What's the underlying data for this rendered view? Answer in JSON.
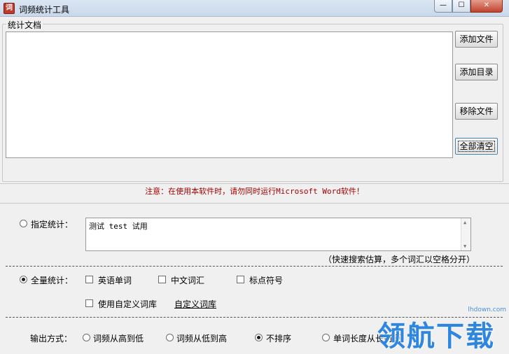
{
  "window": {
    "title": "词频统计工具",
    "icon_glyph": "词",
    "min_glyph": "—",
    "max_glyph": "☐",
    "close_glyph": "✕"
  },
  "documents": {
    "group_label": "统计文档",
    "add_file": "添加文件",
    "add_dir": "添加目录",
    "remove_file": "移除文件",
    "clear_all": "全部清空"
  },
  "notice": {
    "prefix": "注意：在使用本软件时，请勿同时运行",
    "app": "Microsoft Word",
    "suffix": "软件！"
  },
  "specified": {
    "label": "指定统计：",
    "value": "测试 test 试用",
    "hint": "（快速搜索估算，多个词汇以空格分开）",
    "checked": false
  },
  "full": {
    "label": "全量统计：",
    "checked": true,
    "english": "英语单词",
    "chinese": "中文词汇",
    "punct": "标点符号",
    "custom": "使用自定义词库",
    "custom_link": "自定义词库"
  },
  "output": {
    "label": "输出方式：",
    "opt1": "词频从高到低",
    "opt2": "词频从低到高",
    "opt3": "不排序",
    "opt4": "单词长度从长到短",
    "selected": "不排序"
  },
  "watermark": {
    "url": "lhdown.com",
    "text": "领航下载"
  },
  "colors": {
    "notice": "#a30000",
    "watermark": "#2e86de"
  }
}
